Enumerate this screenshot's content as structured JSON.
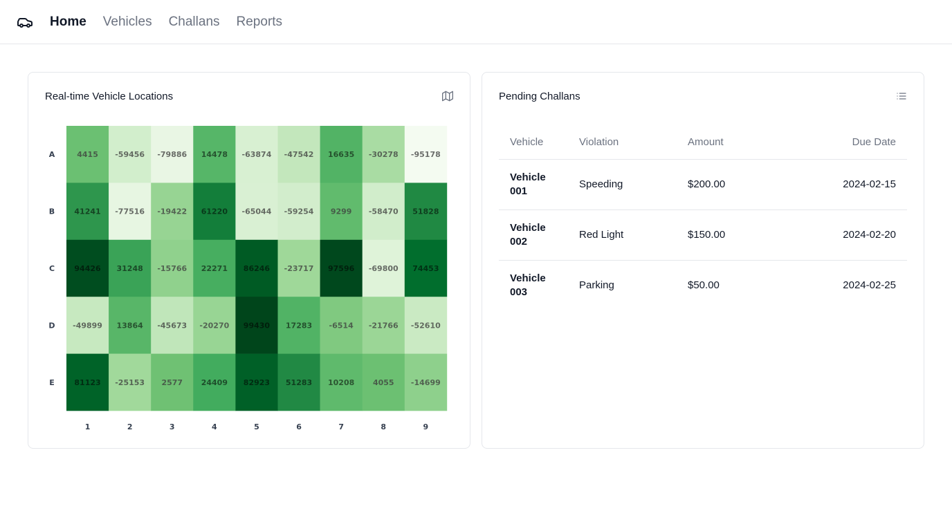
{
  "nav": {
    "logo_icon": "car-icon",
    "items": [
      {
        "label": "Home",
        "active": true
      },
      {
        "label": "Vehicles",
        "active": false
      },
      {
        "label": "Challans",
        "active": false
      },
      {
        "label": "Reports",
        "active": false
      }
    ]
  },
  "locations_card": {
    "title": "Real-time Vehicle Locations",
    "icon": "map-icon"
  },
  "chart_data": {
    "type": "heatmap",
    "rows": [
      "A",
      "B",
      "C",
      "D",
      "E"
    ],
    "columns": [
      "1",
      "2",
      "3",
      "4",
      "5",
      "6",
      "7",
      "8",
      "9"
    ],
    "values": [
      [
        4415,
        -59456,
        -79886,
        14478,
        -63874,
        -47542,
        16635,
        -30278,
        -95178
      ],
      [
        41241,
        -77516,
        -19422,
        61220,
        -65044,
        -59254,
        9299,
        -58470,
        51828
      ],
      [
        94426,
        31248,
        -15766,
        22271,
        86246,
        -23717,
        97596,
        -69800,
        74453
      ],
      [
        -49899,
        13864,
        -45673,
        -20270,
        99430,
        17283,
        -6514,
        -21766,
        -52610
      ],
      [
        81123,
        -25153,
        2577,
        24409,
        82923,
        51283,
        10208,
        4055,
        -14699
      ]
    ],
    "colorscale": "greens",
    "value_range": [
      -100000,
      100000
    ]
  },
  "challans_card": {
    "title": "Pending Challans",
    "icon": "list-icon",
    "columns": [
      "Vehicle",
      "Violation",
      "Amount",
      "Due Date"
    ],
    "rows": [
      {
        "vehicle": "Vehicle 001",
        "violation": "Speeding",
        "amount": "$200.00",
        "due": "2024-02-15"
      },
      {
        "vehicle": "Vehicle 002",
        "violation": "Red Light",
        "amount": "$150.00",
        "due": "2024-02-20"
      },
      {
        "vehicle": "Vehicle 003",
        "violation": "Parking",
        "amount": "$50.00",
        "due": "2024-02-25"
      }
    ]
  }
}
